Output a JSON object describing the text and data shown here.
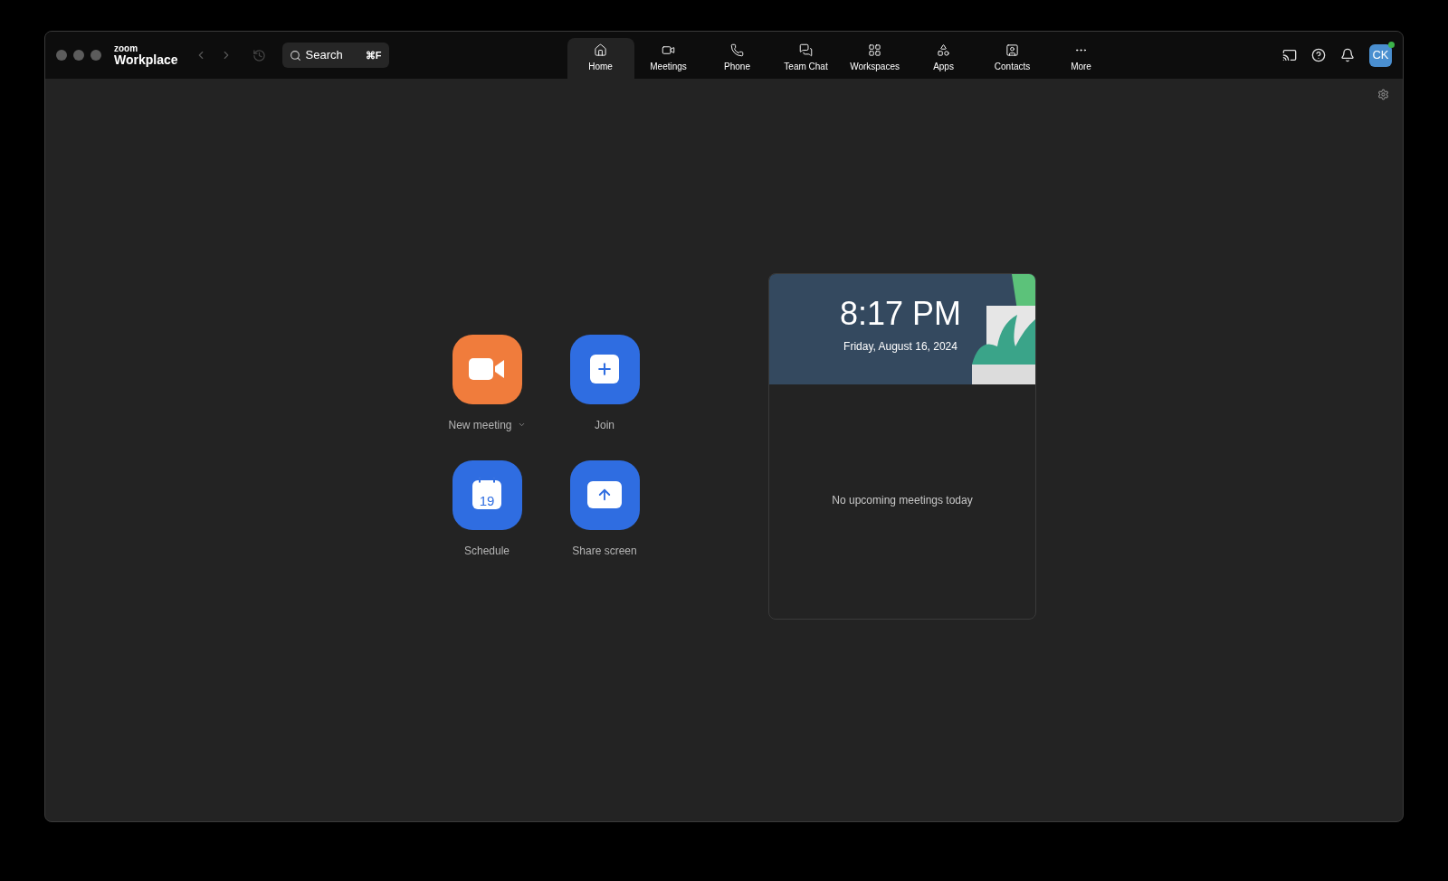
{
  "app": {
    "brand_small": "zoom",
    "brand": "Workplace"
  },
  "search": {
    "placeholder": "Search",
    "shortcut": "⌘F"
  },
  "tabs": [
    {
      "label": "Home",
      "kind": "home",
      "selected": true
    },
    {
      "label": "Meetings",
      "kind": "video",
      "selected": false
    },
    {
      "label": "Phone",
      "kind": "phone",
      "selected": false
    },
    {
      "label": "Team Chat",
      "kind": "chat",
      "selected": false
    },
    {
      "label": "Workspaces",
      "kind": "workspaces",
      "selected": false
    },
    {
      "label": "Apps",
      "kind": "apps",
      "selected": false
    },
    {
      "label": "Contacts",
      "kind": "contacts",
      "selected": false
    },
    {
      "label": "More",
      "kind": "more",
      "selected": false
    }
  ],
  "profile": {
    "initials": "CK",
    "online": true
  },
  "actions": [
    {
      "label": "New meeting",
      "kind": "video",
      "color": "#f07c3c",
      "dropdown": true
    },
    {
      "label": "Join",
      "kind": "plus",
      "color": "#2f6de1",
      "dropdown": false
    },
    {
      "label": "Schedule",
      "kind": "calendar",
      "color": "#2f6de1",
      "dropdown": false,
      "day": "19"
    },
    {
      "label": "Share screen",
      "kind": "share",
      "color": "#2f6de1",
      "dropdown": false
    }
  ],
  "clock": {
    "time": "8:17 PM",
    "date": "Friday, August 16, 2024"
  },
  "meetings": {
    "empty_text": "No upcoming meetings today"
  }
}
